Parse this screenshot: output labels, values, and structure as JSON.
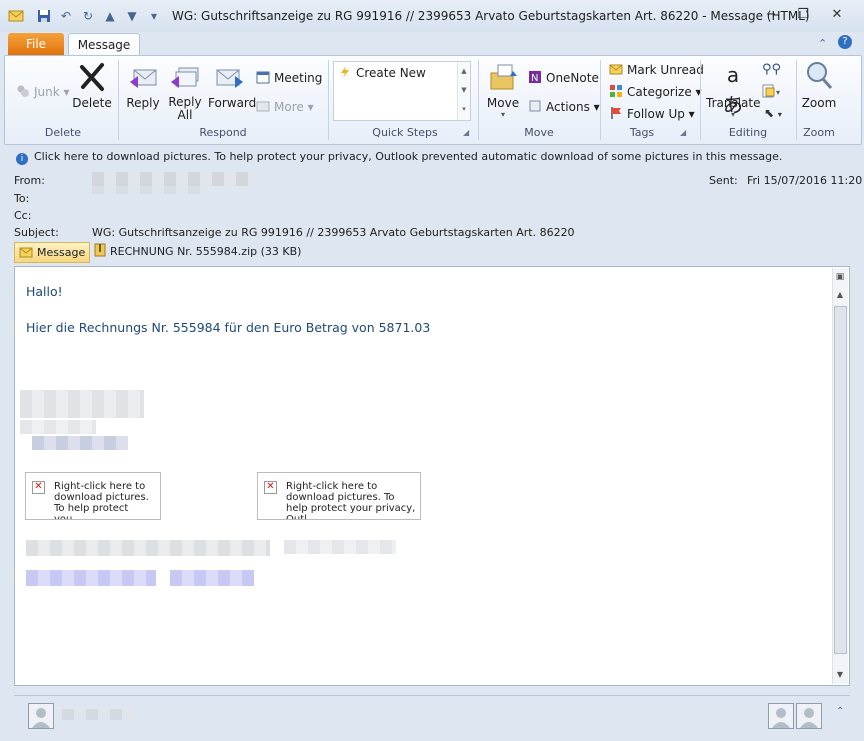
{
  "window": {
    "title": "WG: Gutschriftsanzeige zu RG 991916 // 2399653 Arvato Geburtstagskarten Art. 86220  -  Message (HTML)",
    "minimize_glyph": "−",
    "restore_glyph": "❐",
    "close_glyph": "✕"
  },
  "tabs": {
    "file": "File",
    "message": "Message"
  },
  "ribbon": {
    "delete_group": {
      "label": "Delete",
      "junk": "Junk",
      "delete": "Delete"
    },
    "respond_group": {
      "label": "Respond",
      "reply": "Reply",
      "reply_all_1": "Reply",
      "reply_all_2": "All",
      "forward": "Forward",
      "meeting": "Meeting",
      "more": "More"
    },
    "quicksteps_group": {
      "label": "Quick Steps",
      "create_new": "Create New"
    },
    "move_group": {
      "label": "Move",
      "move": "Move",
      "onenote": "OneNote",
      "actions": "Actions"
    },
    "tags_group": {
      "label": "Tags",
      "mark_unread": "Mark Unread",
      "categorize": "Categorize",
      "follow_up": "Follow Up"
    },
    "editing_group": {
      "label": "Editing",
      "translate": "Translate"
    },
    "zoom_group": {
      "label": "Zoom",
      "zoom": "Zoom"
    }
  },
  "message_header": {
    "info": "Click here to download pictures. To help protect your privacy, Outlook prevented automatic download of some pictures in this message.",
    "from_label": "From:",
    "to_label": "To:",
    "cc_label": "Cc:",
    "subject_label": "Subject:",
    "subject": "WG: Gutschriftsanzeige zu RG 991916 // 2399653 Arvato Geburtstagskarten Art. 86220",
    "sent_label": "Sent:",
    "sent_value": "Fri 15/07/2016 11:20"
  },
  "attachments": {
    "message_tab": "Message",
    "file": "RECHNUNG Nr. 555984.zip (33 KB)"
  },
  "body": {
    "greeting": "Hallo!",
    "line1": "Hier die Rechnungs Nr. 555984 für den Euro Betrag von 5871.03",
    "image1_text": "Right-click here to download pictures. To help protect you...",
    "image2_text": "Right-click here to download pictures.  To help protect your privacy, Outl..."
  },
  "colors": {
    "file_tab": "#e1740a",
    "body_text": "#1f497d",
    "accent": "#2b579a"
  }
}
